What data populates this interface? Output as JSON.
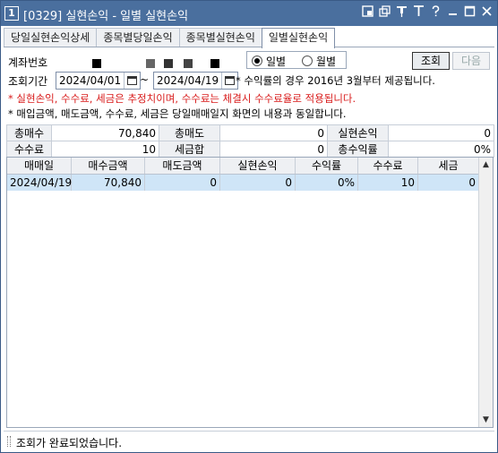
{
  "window": {
    "number": "1",
    "title": "[0329] 실현손익 - 일별 실현손익",
    "icons": [
      "layout-icon",
      "copy-icon",
      "pin-icon",
      "font-icon",
      "help-icon",
      "minimize-icon",
      "maximize-icon",
      "close-icon"
    ]
  },
  "tabs": [
    {
      "label": "당일실현손익상세",
      "active": false
    },
    {
      "label": "종목별당일손익",
      "active": false
    },
    {
      "label": "종목별실현손익",
      "active": false
    },
    {
      "label": "일별실현손익",
      "active": true
    }
  ],
  "account": {
    "label": "계좌번호"
  },
  "mode": {
    "options": [
      "일별",
      "월별"
    ],
    "selected": "일별"
  },
  "buttons": {
    "query": "조회",
    "next": "다음"
  },
  "period": {
    "label": "조회기간",
    "from": "2024/04/01",
    "separator": "~",
    "to": "2024/04/19",
    "note": "* 수익률의 경우 2016년 3월부터 제공됩니다."
  },
  "notices": {
    "red": "* 실현손익, 수수료, 세금은 추정치이며, 수수료는 체결시 수수료율로 적용됩니다.",
    "black": "* 매입금액, 매도금액, 수수료, 세금은 당일매매일지 화면의 내용과 동일합니다."
  },
  "summary": {
    "row1": [
      {
        "label": "총매수",
        "value": "70,840"
      },
      {
        "label": "총매도",
        "value": "0"
      },
      {
        "label": "실현손익",
        "value": "0"
      }
    ],
    "row2": [
      {
        "label": "수수료",
        "value": "10"
      },
      {
        "label": "세금합",
        "value": "0"
      },
      {
        "label": "총수익률",
        "value": "0%"
      }
    ]
  },
  "grid": {
    "columns": [
      "매매일",
      "매수금액",
      "매도금액",
      "실현손익",
      "수익률",
      "수수료",
      "세금"
    ],
    "rows": [
      [
        "2024/04/19",
        "70,840",
        "0",
        "0",
        "0%",
        "10",
        "0"
      ]
    ]
  },
  "status": {
    "text": "조회가 완료되었습니다."
  },
  "colors": {
    "titlebar": "#4a6f9e",
    "selected_row": "#cfe5f7",
    "notice_red": "#d81b1b"
  }
}
